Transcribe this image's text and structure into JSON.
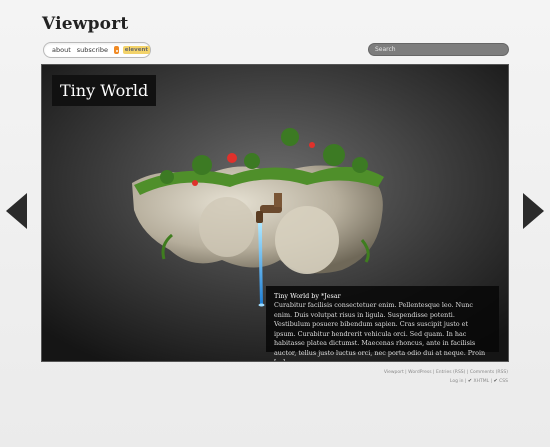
{
  "header": {
    "site_title": "Viewport"
  },
  "nav": {
    "about": "about",
    "subscribe": "subscribe",
    "badge": "elevent"
  },
  "search": {
    "placeholder": "Search"
  },
  "feature": {
    "title": "Tiny World",
    "caption_title": "Tiny World by *Jesar",
    "caption_text": "Curabitur facilisis consectetuer enim. Pellentesque leo. Nunc enim. Duis volutpat risus in ligula. Suspendisse potenti. Vestibulum posuere bibendum sapien. Cras suscipit justo et ipsum. Curabitur hendrerit vehicula orci. Sed quam. In hac habitasse platea dictumst. Maecenas rhoncus, ante in facilisis auctor, tellus justo luctus orci, nec porta odio dui at neque. Proin [...]"
  },
  "footer": {
    "site": "Viewport",
    "wordpress": "WordPress",
    "entries": "Entries (RSS)",
    "comments": "Comments (RSS)",
    "login": "Log in",
    "xhtml": "XHTML",
    "css": "CSS"
  },
  "colors": {
    "frame_bg": "#1e1e1e",
    "caption_bg": "#080808",
    "arrow": "#2b2b2b"
  }
}
